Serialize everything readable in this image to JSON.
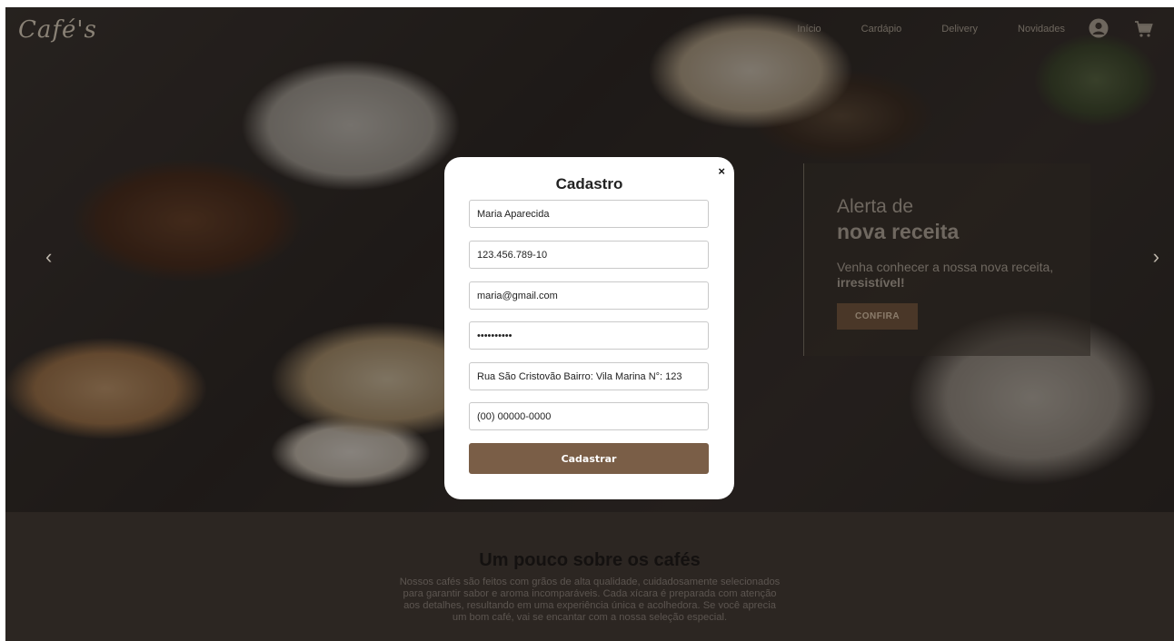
{
  "brand": {
    "logo_text": "Café's"
  },
  "nav": {
    "items": [
      "Início",
      "Cardápio",
      "Delivery",
      "Novidades"
    ]
  },
  "icons": {
    "user": "user-icon",
    "cart": "cart-icon",
    "prev": "chevron-left-icon",
    "next": "chevron-right-icon",
    "close": "close-icon"
  },
  "carousel": {
    "prev_label": "‹",
    "next_label": "›"
  },
  "promo": {
    "title_line1": "Alerta de",
    "title_line2": "nova receita",
    "description": "Venha conhecer a nossa nova receita,",
    "description_bold": "irresistível!",
    "button_label": "CONFIRA"
  },
  "about": {
    "heading": "Um pouco sobre os cafés",
    "text": "Nossos cafés são feitos com grãos de alta qualidade, cuidadosamente selecionados para garantir sabor e aroma incomparáveis. Cada xícara é preparada com atenção aos detalhes, resultando em uma experiência única e acolhedora. Se você aprecia um bom café, vai se encantar com a nossa seleção especial."
  },
  "modal": {
    "title": "Cadastro",
    "close_label": "×",
    "fields": {
      "name": "Maria Aparecida",
      "cpf": "123.456.789-10",
      "email": "maria@gmail.com",
      "password": "••••••••••",
      "address": "Rua São Cristovão Bairro: Vila Marina N°: 123",
      "phone": "(00) 00000-0000"
    },
    "submit_label": "Cadastrar"
  },
  "colors": {
    "accent": "#7a5e47",
    "overlay": "#1a1512"
  }
}
